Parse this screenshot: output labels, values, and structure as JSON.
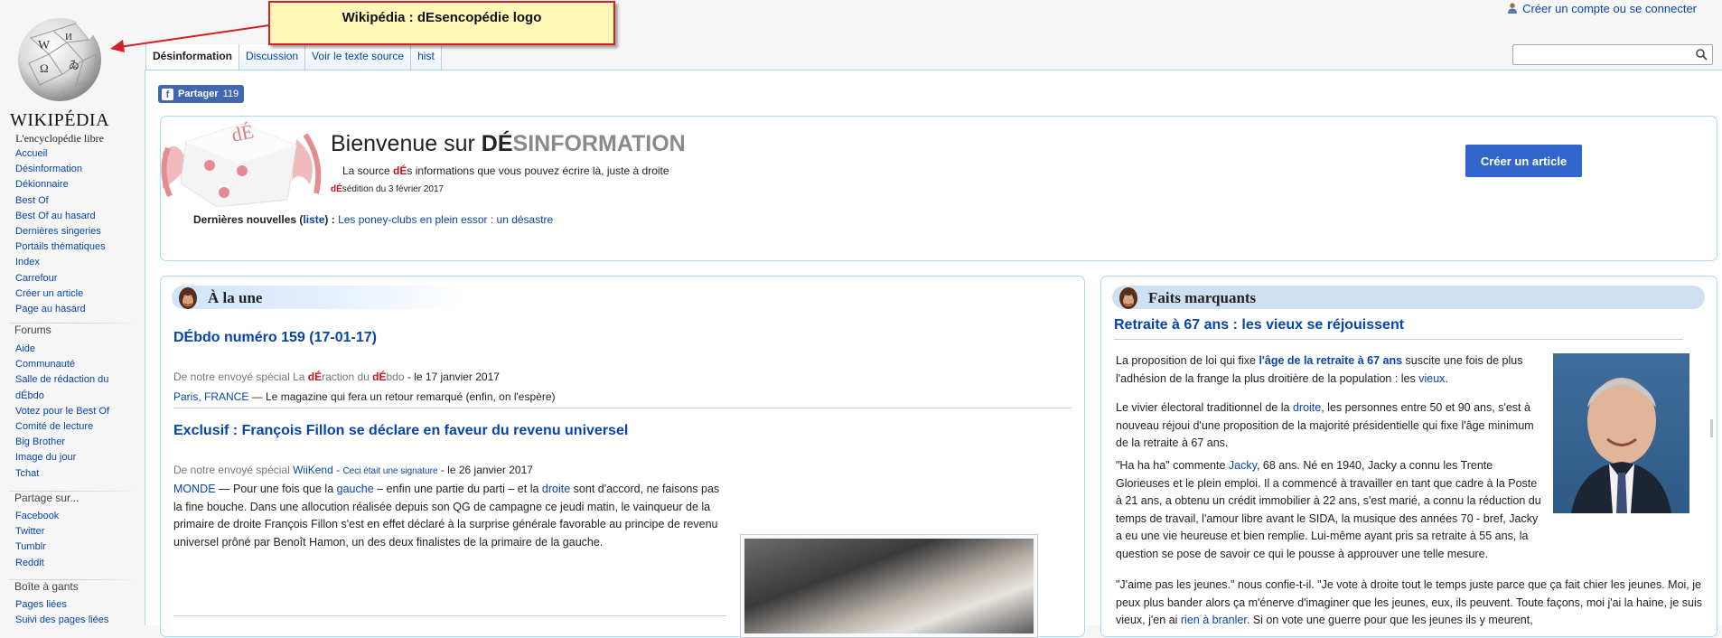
{
  "app": {
    "logo_wordmark": "WIKIPÉDIA",
    "logo_tagline": "L'encyclopédie libre"
  },
  "callout": {
    "text": "Wikipédia : dEsencopédie logo"
  },
  "personal": {
    "create_account": "Créer un compte ou se connecter"
  },
  "search": {
    "placeholder": ""
  },
  "tabs": [
    {
      "label": "Désinformation"
    },
    {
      "label": "Discussion"
    },
    {
      "label": "Voir le texte source"
    },
    {
      "label": "hist"
    }
  ],
  "sidebar": {
    "main": [
      "Accueil",
      "Désinformation",
      "Dékionnaire",
      "Best Of",
      "Best Of au hasard",
      "Dernières singeries",
      "Portails thématiques",
      "Index",
      "Carrefour",
      "Créer un article",
      "Page au hasard"
    ],
    "forums_heading": "Forums",
    "forums": [
      "Aide",
      "Communauté",
      "Salle de rédaction du",
      "dÉbdo",
      "Votez pour le Best Of",
      "Comité de lecture",
      "Big Brother",
      "Image du jour",
      "Tchat"
    ],
    "share_heading": "Partage sur...",
    "share": [
      "Facebook",
      "Twitter",
      "Tumblr",
      "Reddit"
    ],
    "tools_heading": "Boîte à gants",
    "tools": [
      "Pages liées",
      "Suivi des pages liées"
    ]
  },
  "share_button": {
    "label": "Partager",
    "count": "119"
  },
  "welcome": {
    "dice_brand": "dÉ",
    "title_prefix": "Bienvenue sur ",
    "title_brand_a": "DÉ",
    "title_brand_b": "SINFORMATION",
    "subtitle_before": "La source ",
    "subtitle_de": "dÉ",
    "subtitle_after": "s informations que vous pouvez écrire là, juste à droite",
    "edition_de": "dÉ",
    "edition_after": "sédition du 3 février 2017",
    "news_label": "Dernières nouvelles (",
    "news_list_link": "liste",
    "news_label_end": ") :",
    "news_link": "Les poney-clubs en plein essor : un désastre",
    "create_button": "Créer un article"
  },
  "alaune": {
    "heading": "À la une",
    "article1": {
      "title": "DÉbdo numéro 159 (17-01-17)",
      "byline_prefix": "De notre envoyé spécial ",
      "byline_author_a": "La ",
      "byline_author_b": "dÉ",
      "byline_author_c": "raction du ",
      "byline_author_d": "dÉ",
      "byline_author_e": "bdo",
      "byline_date": " - le 17 janvier 2017",
      "place_link": "Paris, FRANCE",
      "place_text": " — Le magazine qui fera un retour remarqué (enfin, on l'espère)"
    },
    "article2": {
      "title": "Exclusif : François Fillon se déclare en faveur du revenu universel",
      "byline_prefix": "De notre envoyé spécial ",
      "byline_author": "WiiKend",
      "byline_sep": " - ",
      "byline_signature": "Ceci était une signature",
      "byline_date": " - le 26 janvier 2017",
      "p_monde": "MONDE",
      "p_1": " — Pour une fois que la ",
      "p_gauche": "gauche",
      "p_2": " – enfin une partie du parti – et la ",
      "p_droite": "droite",
      "p_3": " sont d'accord, ne faisons pas la fine bouche. Dans une allocution réalisée depuis son QG de campagne ce jeudi matin, le vainqueur de la primaire de droite François Fillon s'est en effet déclaré à la surprise générale favorable au principe de revenu universel prôné par Benoît Hamon, un des deux finalistes de la primaire de la gauche."
    }
  },
  "faits": {
    "heading": "Faits marquants",
    "title": "Retraite à 67 ans : les vieux se réjouissent",
    "p1_a": "La proposition de loi qui fixe ",
    "p1_link": "l'âge de la retraite à 67 ans",
    "p1_b": " suscite une fois de plus l'adhésion de la frange la plus droitière de la population : les ",
    "p1_vieux": "vieux",
    "p1_c": ".",
    "p2_a": "Le vivier électoral traditionnel de la ",
    "p2_droite": "droite",
    "p2_b": ", les personnes entre 50 et 90 ans, s'est à nouveau réjoui d'une proposition de la majorité présidentielle qui fixe l'âge minimum de la retraite à 67 ans.",
    "p3_a": "\"Ha ha ha\" commente ",
    "p3_jacky": "Jacky",
    "p3_b": ", 68 ans. Né en 1940, Jacky a connu les Trente Glorieuses et le plein emploi. Il a commencé à travailler en tant que cadre à la Poste à 21 ans, a obtenu un crédit immobilier à 22 ans, s'est marié, a connu la réduction du temps de travail, l'amour libre avant le SIDA, la musique des années 70 - bref, Jacky a eu une vie heureuse et bien remplie. Lui-même ayant pris sa retraite à 55 ans, la question se pose de savoir ce qui le pousse à approuver une telle mesure.",
    "p4_a": "\"J'aime pas les jeunes.\" nous confie-t-il. \"Je vote à droite tout le temps juste parce que ça fait chier les jeunes. Moi, je peux plus bander alors ça m'énerve d'imaginer que les jeunes, eux, ils peuvent. Toute façons, moi j'ai la haine, je suis vieux, j'en ai ",
    "p4_link": "rien à branler",
    "p4_b": ". Si on vote une guerre pour que les jeunes ils y meurent,"
  },
  "colors": {
    "link": "#0645ad",
    "accent_button": "#3366cc",
    "facebook": "#4267b2",
    "box_border": "#a7d7f9",
    "callout_bg": "#fdf8b8",
    "callout_border": "#d61f26",
    "de_red": "#c0141e"
  },
  "icons": {
    "globe": "wikipedia-globe-icon",
    "user": "user-icon",
    "search": "search-icon",
    "facebook": "facebook-icon",
    "dice": "dice-logo-icon",
    "ape": "ape-head-icon"
  }
}
